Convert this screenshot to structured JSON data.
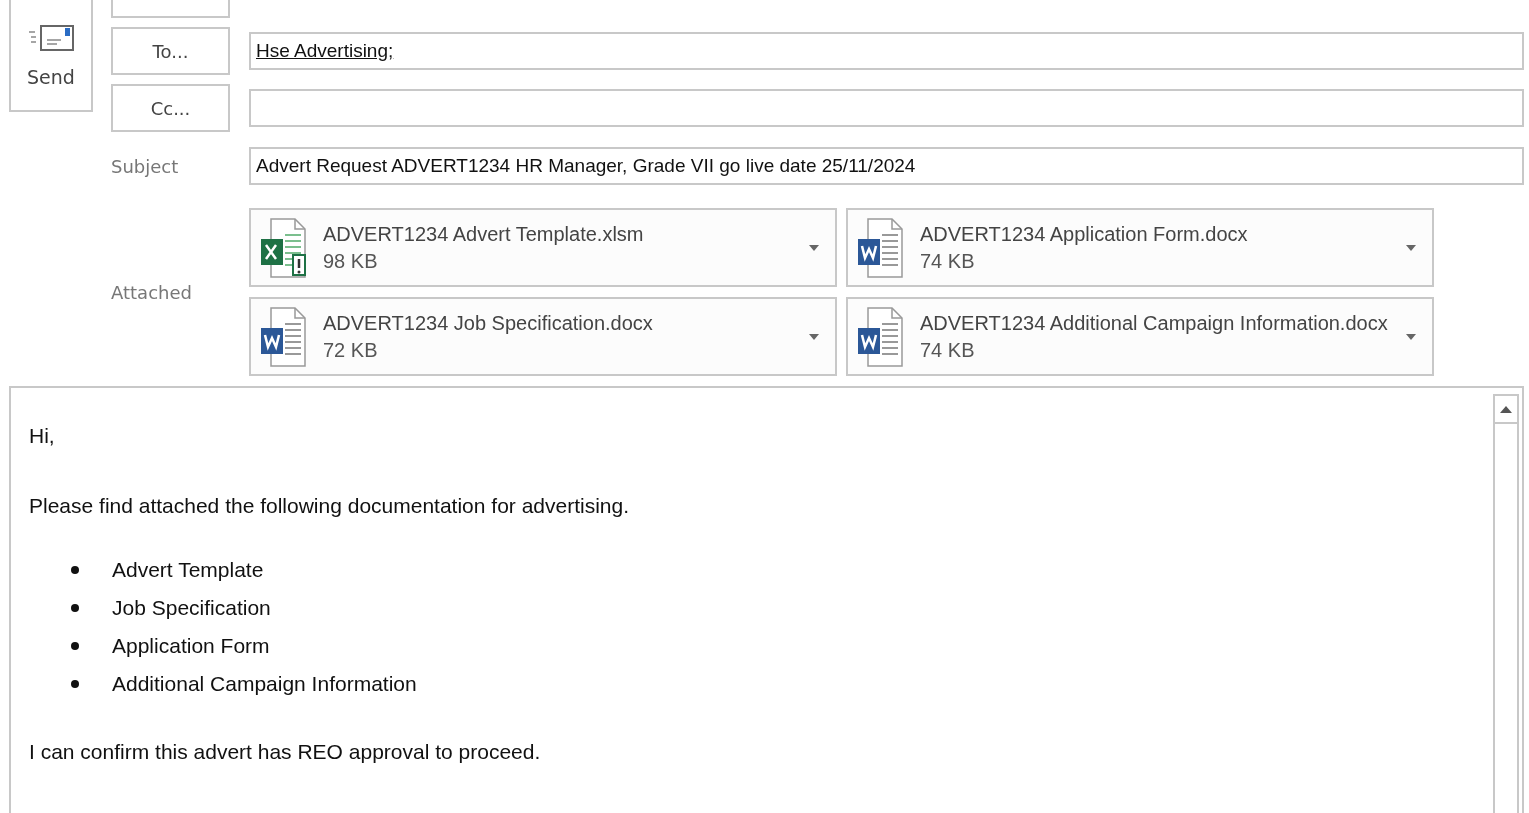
{
  "send_button": {
    "label": "Send"
  },
  "to": {
    "button": "To...",
    "value": "Hse Advertising;"
  },
  "cc": {
    "button": "Cc..."
  },
  "subject": {
    "label": "Subject",
    "value": "Advert Request ADVERT1234 HR Manager, Grade VII go live date 25/11/2024"
  },
  "attachments": {
    "label": "Attached",
    "items": [
      {
        "kind": "excel",
        "name": "ADVERT1234 Advert Template.xlsm",
        "size": "98 KB"
      },
      {
        "kind": "word",
        "name": "ADVERT1234 Application Form.docx",
        "size": "74 KB"
      },
      {
        "kind": "word",
        "name": "ADVERT1234 Job Specification.docx",
        "size": "72 KB"
      },
      {
        "kind": "word",
        "name": "ADVERT1234 Additional Campaign Information.docx",
        "size": "74 KB"
      }
    ]
  },
  "body": {
    "greeting": "Hi,",
    "intro": "Please find attached the following documentation for advertising.",
    "list": [
      "Advert Template",
      "Job Specification",
      "Application Form",
      "Additional Campaign Information"
    ],
    "closing": "I can confirm this advert has REO approval to proceed."
  }
}
